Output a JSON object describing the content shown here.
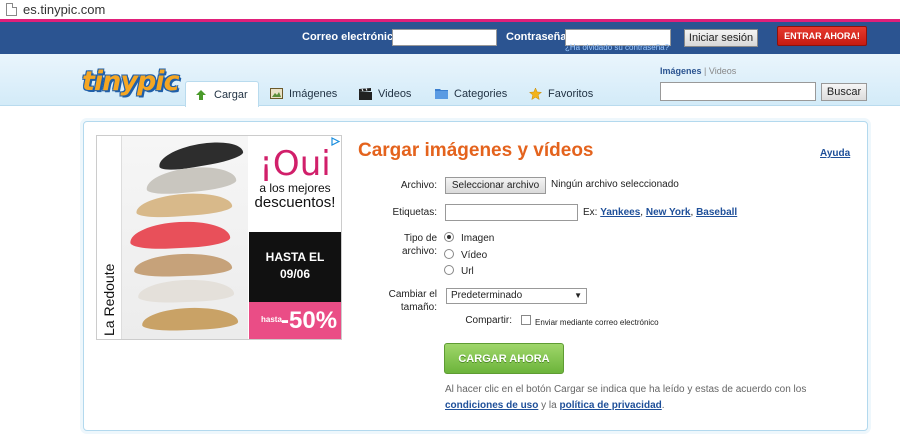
{
  "browser": {
    "url": "es.tinypic.com"
  },
  "login": {
    "email_label": "Correo electrónico:",
    "password_label": "Contraseña:",
    "login_button": "Iniciar sesión",
    "signup_button": "ENTRAR AHORA!",
    "forgot_link": "¿Ha olvidado su contraseña?"
  },
  "header": {
    "logo": "tinypic",
    "tabs": [
      {
        "label": "Cargar",
        "icon": "upload-arrow-icon",
        "active": true
      },
      {
        "label": "Imágenes",
        "icon": "images-icon",
        "active": false
      },
      {
        "label": "Videos",
        "icon": "film-clapper-icon",
        "active": false
      },
      {
        "label": "Categories",
        "icon": "folder-icon",
        "active": false
      },
      {
        "label": "Favoritos",
        "icon": "star-icon",
        "active": false
      }
    ],
    "search": {
      "type_images": "Imágenes",
      "type_separator": "|",
      "type_videos": "Videos",
      "button": "Buscar"
    }
  },
  "ad": {
    "brand": "La Redoute",
    "headline": "¡Oui",
    "line1": "a los mejores",
    "line2": "descuentos!",
    "until_label": "HASTA EL",
    "until_date": "09/06",
    "discount_prefix": "hasta",
    "discount": "-50%"
  },
  "upload": {
    "title": "Cargar imágenes y vídeos",
    "help_link": "Ayuda",
    "file_label": "Archivo:",
    "file_button": "Seleccionar archivo",
    "file_status": "Ningún archivo seleccionado",
    "tags_label": "Etiquetas:",
    "tags_example_prefix": "Ex:",
    "tags_examples": [
      "Yankees",
      "New York",
      "Baseball"
    ],
    "filetype_label_1": "Tipo de",
    "filetype_label_2": "archivo:",
    "filetypes": [
      "Imagen",
      "Vídeo",
      "Url"
    ],
    "resize_label_1": "Cambiar el",
    "resize_label_2": "tamaño:",
    "resize_value": "Predeterminado",
    "share_label": "Compartir:",
    "share_option": "Enviar mediante correo electrónico",
    "submit_button": "CARGAR AHORA",
    "terms_text_1": "Al hacer clic en el botón Cargar se indica que ha leído y estas de acuerdo con los",
    "terms_link_1": "condiciones de uso",
    "terms_text_2": "y la",
    "terms_link_2": "política de privacidad",
    "terms_text_3": "."
  },
  "colors": {
    "login_bar": "#2b5491",
    "title_orange": "#e4631d",
    "link_blue": "#1e4f99",
    "upload_green": "#6cb43b",
    "ad_pink": "#ea4d86"
  }
}
